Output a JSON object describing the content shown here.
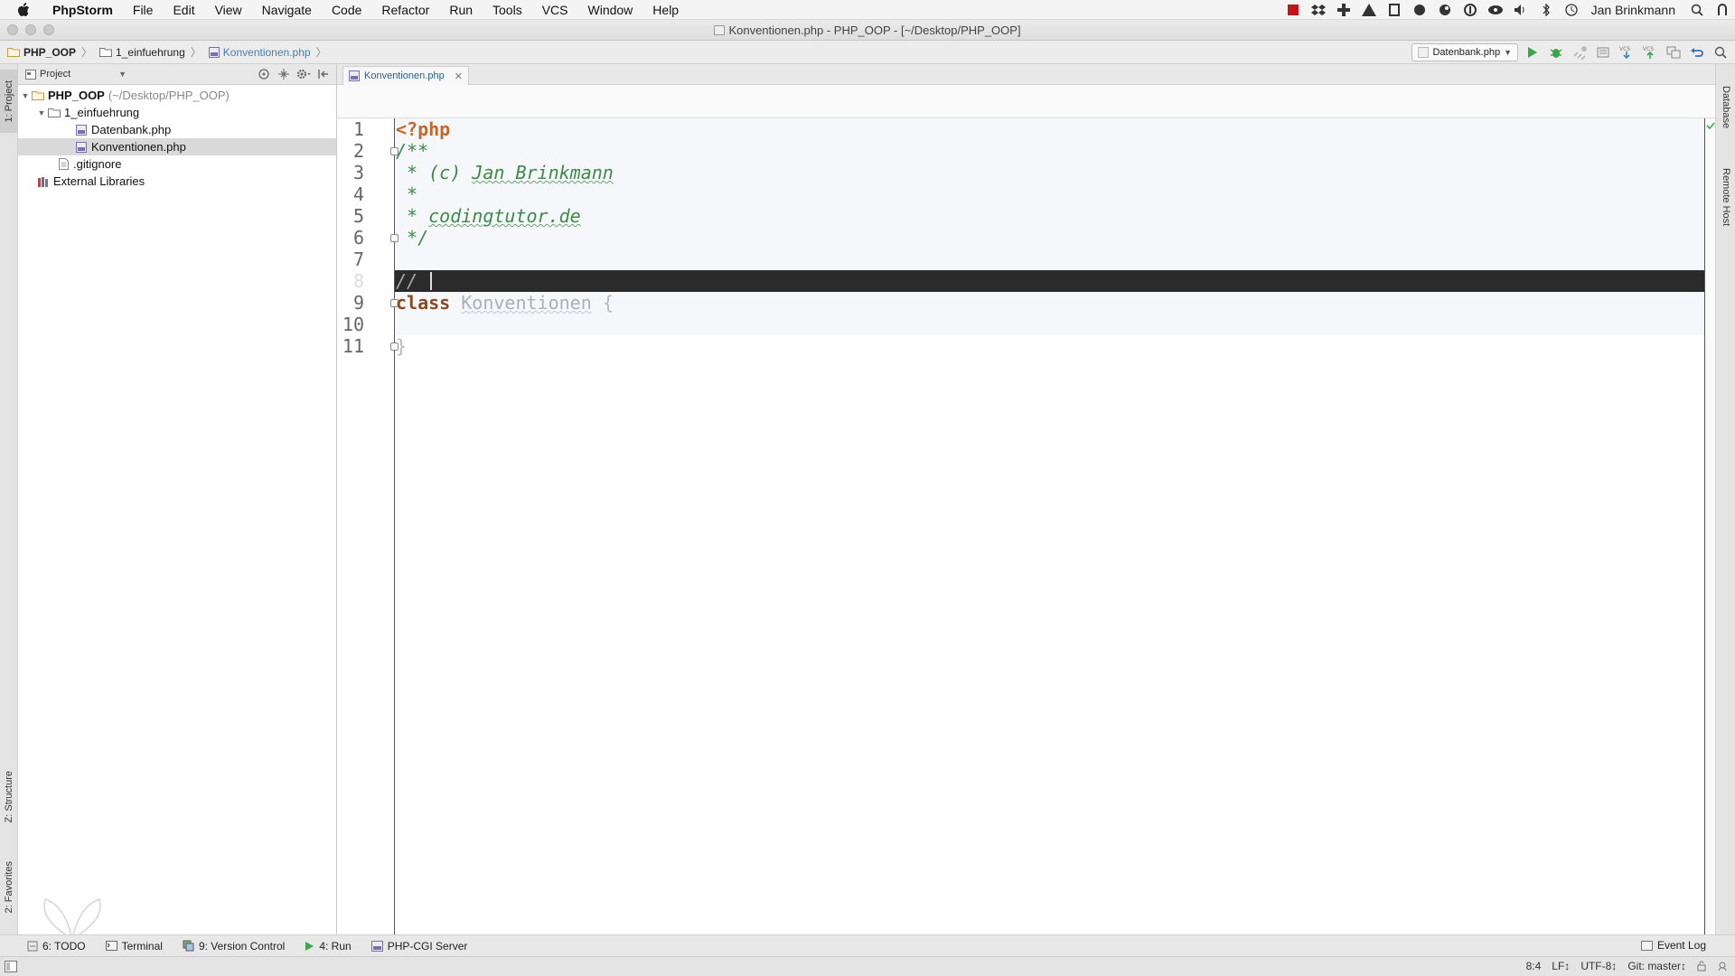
{
  "menubar": {
    "app_name": "PhpStorm",
    "items": [
      "File",
      "Edit",
      "View",
      "Navigate",
      "Code",
      "Refactor",
      "Run",
      "Tools",
      "VCS",
      "Window",
      "Help"
    ],
    "user": "Jan Brinkmann"
  },
  "window": {
    "title": "Konventionen.php - PHP_OOP - [~/Desktop/PHP_OOP]"
  },
  "breadcrumb": {
    "items": [
      "PHP_OOP",
      "1_einfuehrung",
      "Konventionen.php"
    ]
  },
  "toolbar": {
    "run_config": "Datenbank.php"
  },
  "tool_strips": {
    "left_top": "1: Project",
    "left_structure": "Z: Structure",
    "left_favorites": "2: Favorites",
    "right_database": "Database",
    "right_remote": "Remote Host"
  },
  "project_panel": {
    "view_mode": "Project",
    "tree": {
      "root_name": "PHP_OOP",
      "root_path": "(~/Desktop/PHP_OOP)",
      "folder": "1_einfuehrung",
      "file_1": "Datenbank.php",
      "file_2": "Konventionen.php",
      "gitignore": ".gitignore",
      "external": "External Libraries"
    }
  },
  "editor": {
    "tab_label": "Konventionen.php",
    "line_numbers": [
      "1",
      "2",
      "3",
      "4",
      "5",
      "6",
      "7",
      "8",
      "9",
      "10",
      "11"
    ],
    "code": {
      "l1": "<?php",
      "l2": "/**",
      "l3_prefix": " * (c) ",
      "l3_name": "Jan Brinkmann",
      "l4": " *",
      "l5_prefix": " * ",
      "l5_site": "codingtutor.de",
      "l6": " */",
      "l8": "// ",
      "l9_kw": "class",
      "l9_name": "Konventionen",
      "l9_brace": "{",
      "l11": "}"
    }
  },
  "bottom_tools": {
    "todo": "6: TODO",
    "terminal": "Terminal",
    "vcs": "9: Version Control",
    "run": "4: Run",
    "php_cgi": "PHP-CGI Server",
    "event_log": "Event Log"
  },
  "statusbar": {
    "position": "8:4",
    "line_sep": "LF↕",
    "encoding": "UTF-8↕",
    "git": "Git: master↕"
  },
  "colors": {
    "keyword": "#c0692f",
    "doc_comment": "#3f8a48",
    "caret_row": "#2b2b2b",
    "run_green": "#3aa64a"
  }
}
